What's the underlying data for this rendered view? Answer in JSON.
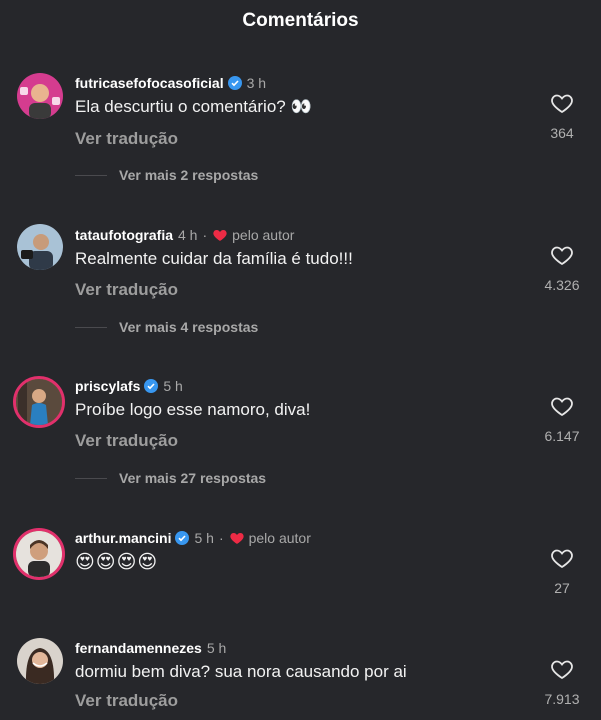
{
  "header": {
    "title": "Comentários"
  },
  "comments": [
    {
      "username": "futricasefofocasoficial",
      "verified": true,
      "time": "3 h",
      "text": "Ela descurtiu o comentário? 👀",
      "translate": "Ver tradução",
      "replies": "Ver mais 2 respostas",
      "likes": "364"
    },
    {
      "username": "tataufotografia",
      "verified": false,
      "time": "4 h",
      "separator": "·",
      "author_badge": "pelo autor",
      "text": "Realmente cuidar da família é tudo!!!",
      "translate": "Ver tradução",
      "replies": "Ver mais 4 respostas",
      "likes": "4.326"
    },
    {
      "username": "priscylafs",
      "verified": true,
      "time": "5 h",
      "text": "Proíbe logo esse namoro, diva!",
      "translate": "Ver tradução",
      "replies": "Ver mais 27 respostas",
      "likes": "6.147"
    },
    {
      "username": "arthur.mancini",
      "verified": true,
      "time": "5 h",
      "separator": "·",
      "author_badge": "pelo autor",
      "text": "😍😍😍😍",
      "likes": "27"
    },
    {
      "username": "fernandamennezes",
      "verified": false,
      "time": "5 h",
      "text": "dormiu bem diva? sua nora causando por ai",
      "translate": "Ver tradução",
      "likes": "7.913"
    }
  ],
  "colors": {
    "background": "#26272b",
    "verified_blue": "#3897f0",
    "author_heart": "#ed2b45",
    "story_ring": "#e1306c"
  }
}
